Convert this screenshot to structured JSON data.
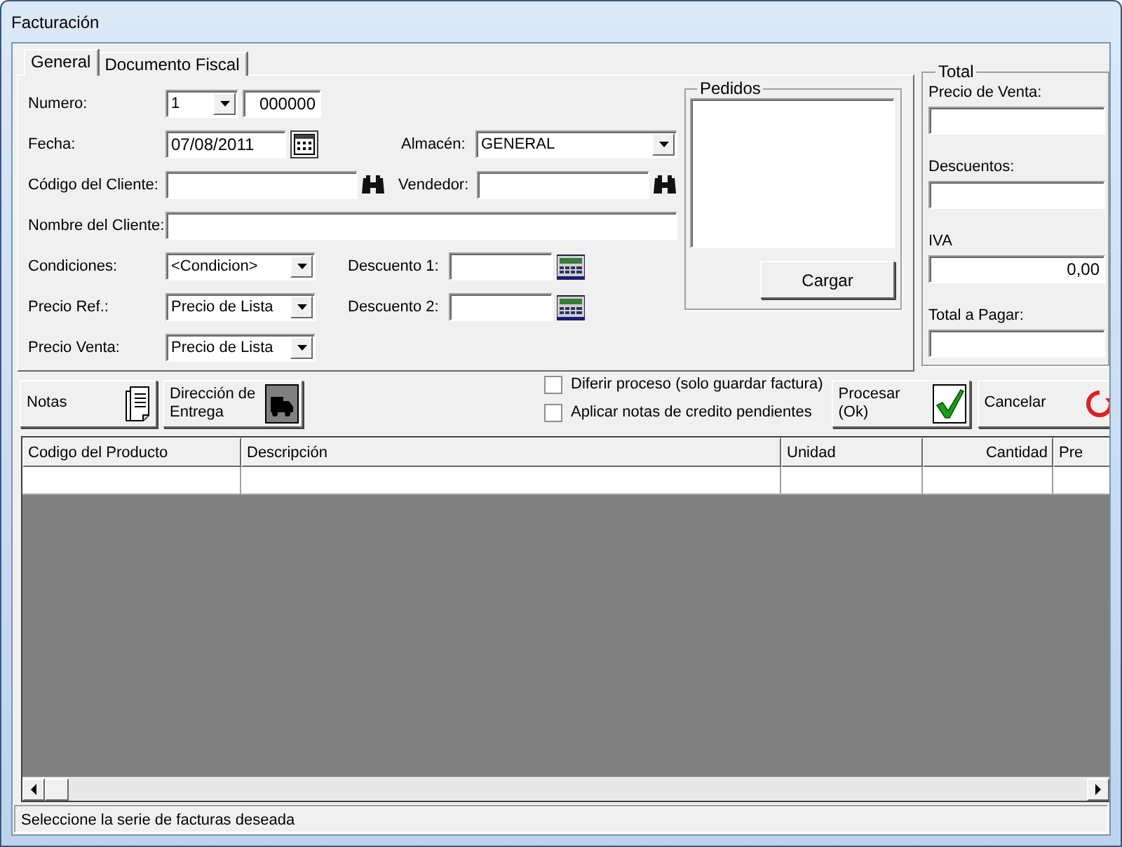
{
  "window": {
    "title": "Facturación"
  },
  "tabs": [
    {
      "label": "General",
      "selected": true
    },
    {
      "label": "Documento Fiscal",
      "selected": false
    }
  ],
  "numero": {
    "label": "Numero:",
    "serie": "1",
    "value": "000000"
  },
  "fecha": {
    "label": "Fecha:",
    "value": "07/08/2011"
  },
  "almacen": {
    "label": "Almacén:",
    "value": "GENERAL"
  },
  "codigo_cliente": {
    "label": "Código del Cliente:"
  },
  "vendedor": {
    "label": "Vendedor:"
  },
  "nombre_cliente": {
    "label": "Nombre del Cliente:"
  },
  "condiciones": {
    "label": "Condiciones:",
    "value": "<Condicion>"
  },
  "descuento_1": {
    "label": "Descuento 1:"
  },
  "precio_ref": {
    "label": "Precio Ref.:",
    "value": "Precio de Lista"
  },
  "descuento_2": {
    "label": "Descuento 2:"
  },
  "precio_venta": {
    "label": "Precio Venta:",
    "value": "Precio de Lista"
  },
  "pedidos": {
    "title": "Pedidos",
    "button": "Cargar"
  },
  "total": {
    "title": "Total",
    "fields": [
      {
        "label": "Precio de Venta:"
      },
      {
        "label": "Descuentos:"
      },
      {
        "label": "IVA",
        "value": "0,00"
      },
      {
        "label": "Total a Pagar:"
      }
    ]
  },
  "toolbar": {
    "notas": {
      "lines": [
        {
          "text": "Notas"
        }
      ]
    },
    "direccion": {
      "lines": [
        {
          "text": "Dirección de"
        },
        {
          "text": "Entrega"
        }
      ]
    },
    "options": [
      {
        "label": "Diferir proceso (solo guardar factura)",
        "checked": false
      },
      {
        "label": "Aplicar notas de credito pendientes",
        "checked": false
      }
    ],
    "procesar": {
      "lines": [
        {
          "text": "Procesar"
        },
        {
          "text": "(Ok)"
        }
      ]
    },
    "cancelar": {
      "lines": [
        {
          "text": "Cancelar"
        }
      ]
    }
  },
  "table": {
    "columns": [
      {
        "label": "Codigo del Producto"
      },
      {
        "label": "Descripción"
      },
      {
        "label": "Unidad"
      },
      {
        "label": "Cantidad"
      },
      {
        "label": "Pre"
      }
    ]
  },
  "status_bar": "Seleccione la serie de facturas deseada"
}
